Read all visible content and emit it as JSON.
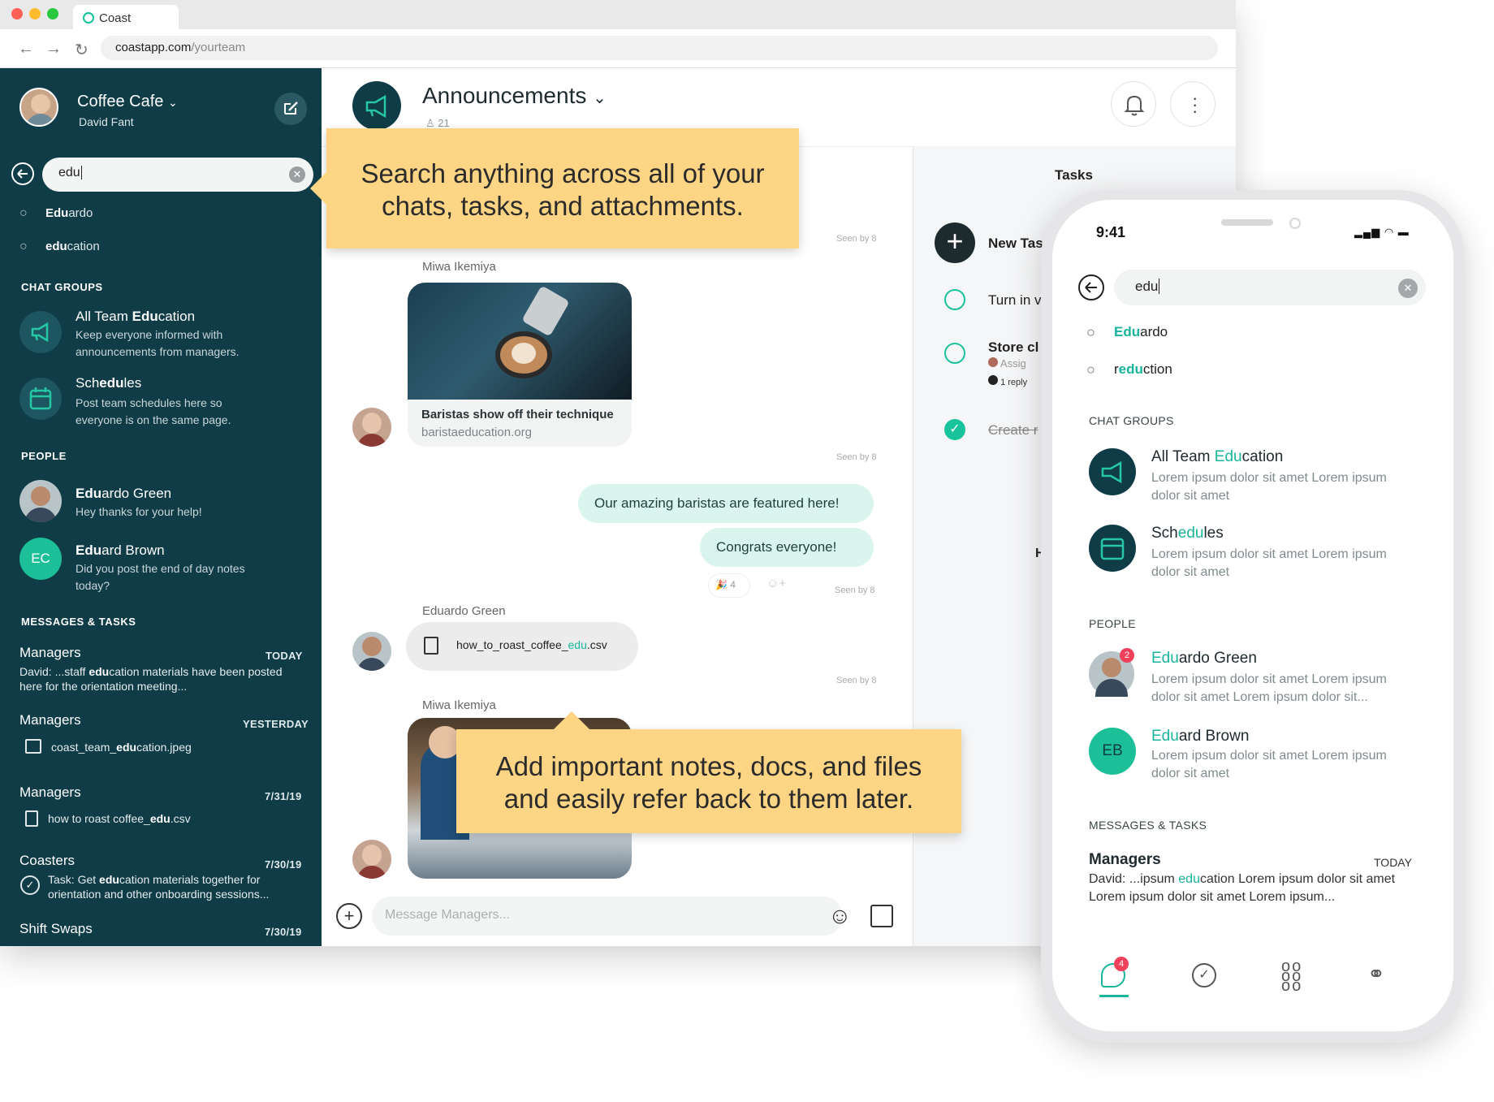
{
  "browser": {
    "tab_title": "Coast",
    "url_domain": "coastapp.com",
    "url_path": "/yourteam"
  },
  "sidebar": {
    "team_name": "Coffee Cafe",
    "user_name": "David Fant",
    "search_value": "edu",
    "suggestions": [
      {
        "match": "Edu",
        "rest": "ardo"
      },
      {
        "match": "edu",
        "rest": "cation"
      }
    ],
    "chat_groups_heading": "CHAT GROUPS",
    "chat_groups": [
      {
        "pre": "All Team ",
        "match": "Edu",
        "post": "cation",
        "desc": "Keep everyone informed with announcements from managers."
      },
      {
        "pre": "Sch",
        "match": "edu",
        "post": "les",
        "desc": "Post team schedules here so everyone is on the same page."
      }
    ],
    "people_heading": "PEOPLE",
    "people": [
      {
        "match": "Edu",
        "post": "ardo Green",
        "desc": "Hey thanks for your help!"
      },
      {
        "initials": "EC",
        "match": "Edu",
        "post": "ard Brown",
        "desc": "Did you post the end of day notes today?"
      }
    ],
    "messages_heading": "MESSAGES & TASKS",
    "messages": [
      {
        "title": "Managers",
        "date": "TODAY",
        "pre": "David: ...staff ",
        "match": "edu",
        "post": "cation materials have been posted here for the orientation meeting..."
      },
      {
        "title": "Managers",
        "date": "YESTERDAY",
        "pre": "coast_team_",
        "match": "edu",
        "post": "cation.jpeg"
      },
      {
        "title": "Managers",
        "date": "7/31/19",
        "pre": "how to roast coffee_",
        "match": "edu",
        "post": ".csv"
      },
      {
        "title": "Coasters",
        "date": "7/30/19",
        "pre": "Task: Get ",
        "match": "edu",
        "post": "cation materials together for orientation and other onboarding sessions..."
      },
      {
        "title": "Shift Swaps",
        "date": "7/30/19"
      }
    ]
  },
  "main": {
    "channel_title": "Announcements",
    "member_count": "21",
    "seen_label": "Seen by 8",
    "sender_1": "Miwa Ikemiya",
    "link_title": "Baristas show off their technique",
    "link_domain": "baristaeducation.org",
    "bubble_1": "Our amazing baristas are featured here!",
    "bubble_2": "Congrats everyone!",
    "reaction_count": "4",
    "sender_2": "Eduardo Green",
    "file_pre": "how_to_roast_coffee_",
    "file_match": "edu",
    "file_post": ".csv",
    "sender_3": "Miwa Ikemiya",
    "composer_placeholder": "Message Managers..."
  },
  "tasks": {
    "heading": "Tasks",
    "new_task": "New Tas",
    "items": [
      "Turn in v",
      "Store cl",
      "Create r"
    ],
    "assign": "Assig",
    "reply": "1 reply",
    "hide": "Hide"
  },
  "callouts": {
    "search": "Search anything across all of your chats, tasks, and attachments.",
    "notes": "Add important notes, docs, and files and easily refer back to them later."
  },
  "phone": {
    "time": "9:41",
    "search_value": "edu",
    "suggestions": [
      {
        "pre": "",
        "match": "Edu",
        "post": "ardo"
      },
      {
        "pre": "r",
        "match": "edu",
        "post": "ction"
      }
    ],
    "chat_groups_heading": "CHAT GROUPS",
    "chat_groups": [
      {
        "pre": "All Team ",
        "match": "Edu",
        "post": "cation",
        "desc": "Lorem ipsum dolor sit amet Lorem ipsum dolor sit amet"
      },
      {
        "pre": "Sch",
        "match": "edu",
        "post": "les",
        "desc": "Lorem ipsum dolor sit amet Lorem ipsum dolor sit amet"
      }
    ],
    "people_heading": "PEOPLE",
    "people": [
      {
        "match": "Edu",
        "post": "ardo Green",
        "desc": "Lorem ipsum dolor sit amet Lorem ipsum dolor sit amet Lorem ipsum dolor sit...",
        "badge": "2"
      },
      {
        "initials": "EB",
        "match": "Edu",
        "post": "ard Brown",
        "desc": "Lorem ipsum dolor sit amet Lorem ipsum dolor sit amet"
      }
    ],
    "messages_heading": "MESSAGES & TASKS",
    "message": {
      "title": "Managers",
      "date": "TODAY",
      "pre": "David: ...ipsum ",
      "match": "edu",
      "post": "cation Lorem ipsum dolor sit amet Lorem ipsum dolor sit amet Lorem ipsum..."
    },
    "tab_badge": "4"
  },
  "colors": {
    "sidebar": "#0f3c46",
    "accent": "#18b59a",
    "callout": "#fdd584"
  }
}
